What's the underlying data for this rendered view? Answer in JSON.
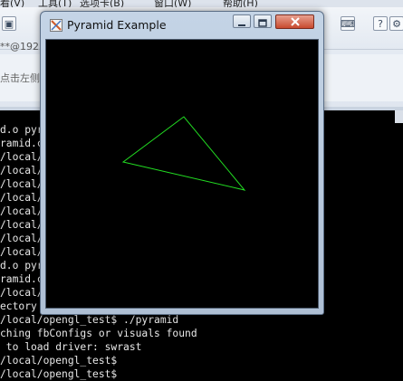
{
  "host": {
    "menu": [
      "看(V)",
      "工具(T)",
      "选项卡(B)",
      "窗口(W)",
      "帮助(H)"
    ],
    "address": "**@192",
    "hint": "点击左侧"
  },
  "terminal": {
    "lines": [
      "d.o pyr",
      "ramid.c",
      "/local/",
      "/local/",
      "/local/",
      "/local/",
      "/local/",
      "/local/",
      "/local/",
      "/local/",
      "d.o pyr",
      "ramid.c",
      "/local/",
      "ectory",
      "/local/opengl_test$ ./pyramid",
      "ching fbConfigs or visuals found",
      " to load driver: swrast",
      "/local/opengl_test$",
      "/local/opengl_test$"
    ]
  },
  "window": {
    "title": "Pyramid Example",
    "min_icon": "minimize-icon",
    "max_icon": "maximize-icon",
    "close_icon": "close-icon",
    "triangle_color": "#22dd22"
  },
  "colors": {
    "canvas_bg": "#000000",
    "terminal_fg": "#e8e8e8"
  }
}
